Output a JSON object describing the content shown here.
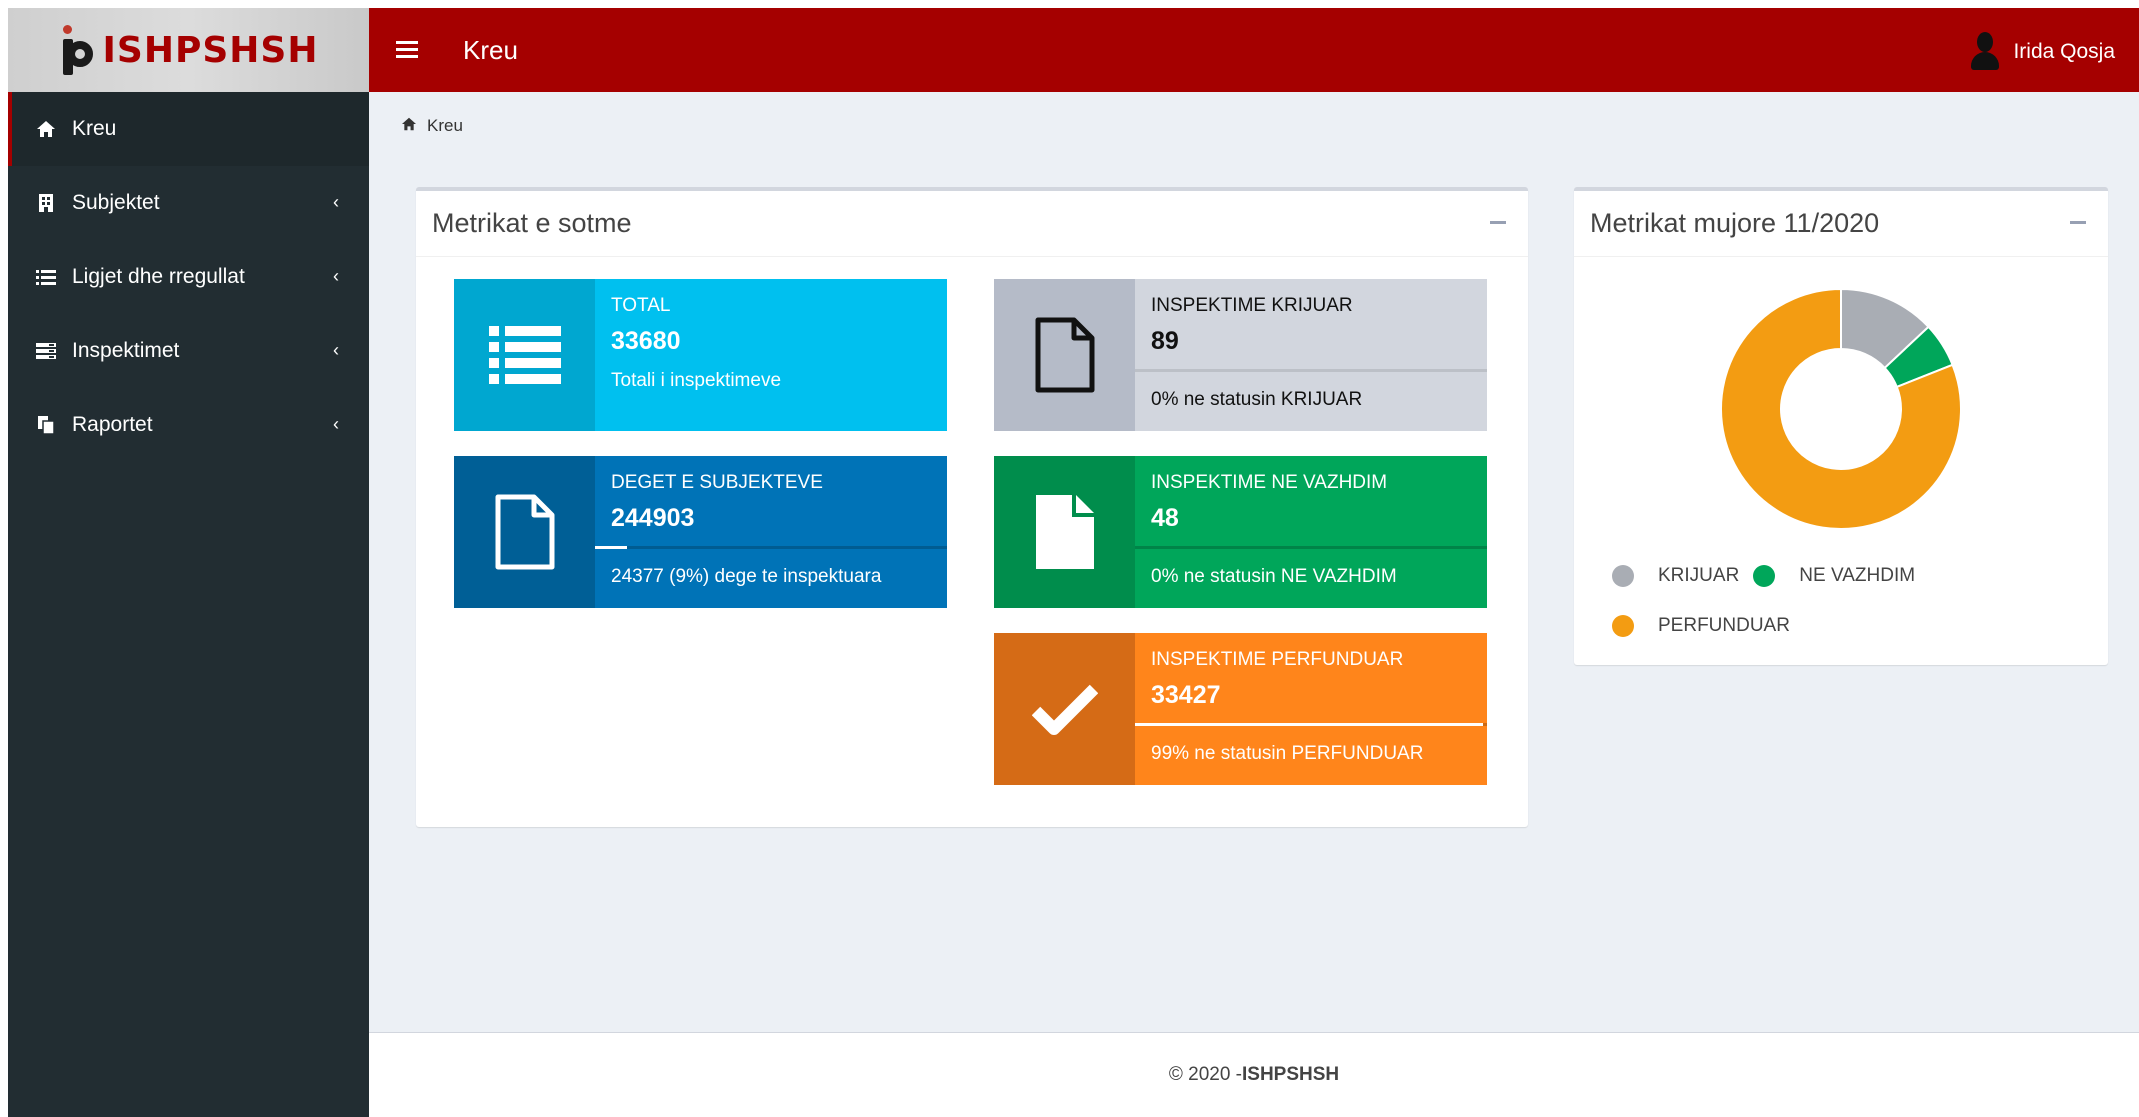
{
  "app": {
    "logo_text": "ISHPSHSH",
    "brand_color": "#a50000"
  },
  "sidebar": {
    "items": [
      {
        "label": "Kreu",
        "icon": "home-icon",
        "active": true
      },
      {
        "label": "Subjektet",
        "icon": "building-icon"
      },
      {
        "label": "Ligjet dhe rregullat",
        "icon": "list-icon"
      },
      {
        "label": "Inspektimet",
        "icon": "tasks-icon"
      },
      {
        "label": "Raportet",
        "icon": "copy-icon"
      }
    ]
  },
  "header": {
    "title": "Kreu",
    "user_name": "Irida Qosja"
  },
  "breadcrumb": {
    "label": "Kreu"
  },
  "daily_metrics": {
    "title": "Metrikat e sotme",
    "total": {
      "label": "TOTAL",
      "value": "33680",
      "desc": "Totali i inspektimeve",
      "color": "#00c0ef",
      "icon_bg": "#00a7d0"
    },
    "branches": {
      "label": "DEGET E SUBJEKTEVE",
      "value": "244903",
      "footer": "24377 (9%) dege te inspektuara",
      "progress": 0.09,
      "color": "#0073b7",
      "icon_bg": "#005f96"
    },
    "created": {
      "label": "INSPEKTIME KRIJUAR",
      "value": "89",
      "footer": "0% ne statusin KRIJUAR",
      "progress": 0,
      "color": "#d2d6de",
      "icon_bg": "#b5bbc8"
    },
    "in_progress": {
      "label": "INSPEKTIME NE VAZHDIM",
      "value": "48",
      "footer": "0% ne statusin NE VAZHDIM",
      "progress": 0,
      "color": "#00a65a",
      "icon_bg": "#008d4c"
    },
    "finished": {
      "label": "INSPEKTIME PERFUNDUAR",
      "value": "33427",
      "footer": "99% ne statusin PERFUNDUAR",
      "progress": 0.99,
      "color": "#ff851b",
      "icon_bg": "#d56b16"
    }
  },
  "monthly_metrics": {
    "title": "Metrikat mujore 11/2020",
    "legend": [
      {
        "label": "KRIJUAR",
        "color": "#a9adb4"
      },
      {
        "label": "NE VAZHDIM",
        "color": "#00a65a"
      },
      {
        "label": "PERFUNDUAR",
        "color": "#f39c12"
      }
    ]
  },
  "chart_data": {
    "type": "pie",
    "categories": [
      "KRIJUAR",
      "NE VAZHDIM",
      "PERFUNDUAR"
    ],
    "values": [
      13,
      6,
      81
    ],
    "legend_position": "bottom-left"
  },
  "footer": {
    "prefix": "© 2020 - ",
    "brand": "ISHPSHSH"
  }
}
